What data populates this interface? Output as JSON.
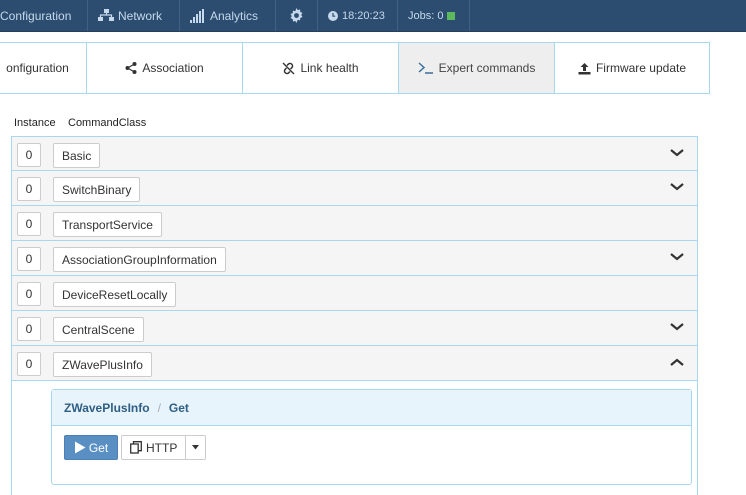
{
  "topnav": {
    "configuration": "Configuration",
    "network": "Network",
    "analytics": "Analytics",
    "time": "18:20:23",
    "jobs": "Jobs: 0"
  },
  "tabs": [
    {
      "label": "onfiguration"
    },
    {
      "label": "Association"
    },
    {
      "label": "Link health"
    },
    {
      "label": "Expert commands"
    },
    {
      "label": "Firmware update"
    }
  ],
  "headers": {
    "instance": "Instance",
    "commandclass": "CommandClass"
  },
  "command_classes": [
    {
      "instance": "0",
      "name": "Basic",
      "expandable": true
    },
    {
      "instance": "0",
      "name": "SwitchBinary",
      "expandable": true
    },
    {
      "instance": "0",
      "name": "TransportService",
      "expandable": false
    },
    {
      "instance": "0",
      "name": "AssociationGroupInformation",
      "expandable": true
    },
    {
      "instance": "0",
      "name": "DeviceResetLocally",
      "expandable": false
    },
    {
      "instance": "0",
      "name": "CentralScene",
      "expandable": true
    },
    {
      "instance": "0",
      "name": "ZWavePlusInfo",
      "expandable": true,
      "expanded": true
    }
  ],
  "expanded_panel": {
    "breadcrumb_class": "ZWavePlusInfo",
    "breadcrumb_sep": "/",
    "breadcrumb_cmd": "Get",
    "get_label": "Get",
    "http_label": "HTTP"
  },
  "colors": {
    "nav_bg": "#2c4d70",
    "accent_border": "#a9d7f0",
    "primary_button": "#5a8fc4",
    "jobs_ok": "#5cb85c"
  }
}
